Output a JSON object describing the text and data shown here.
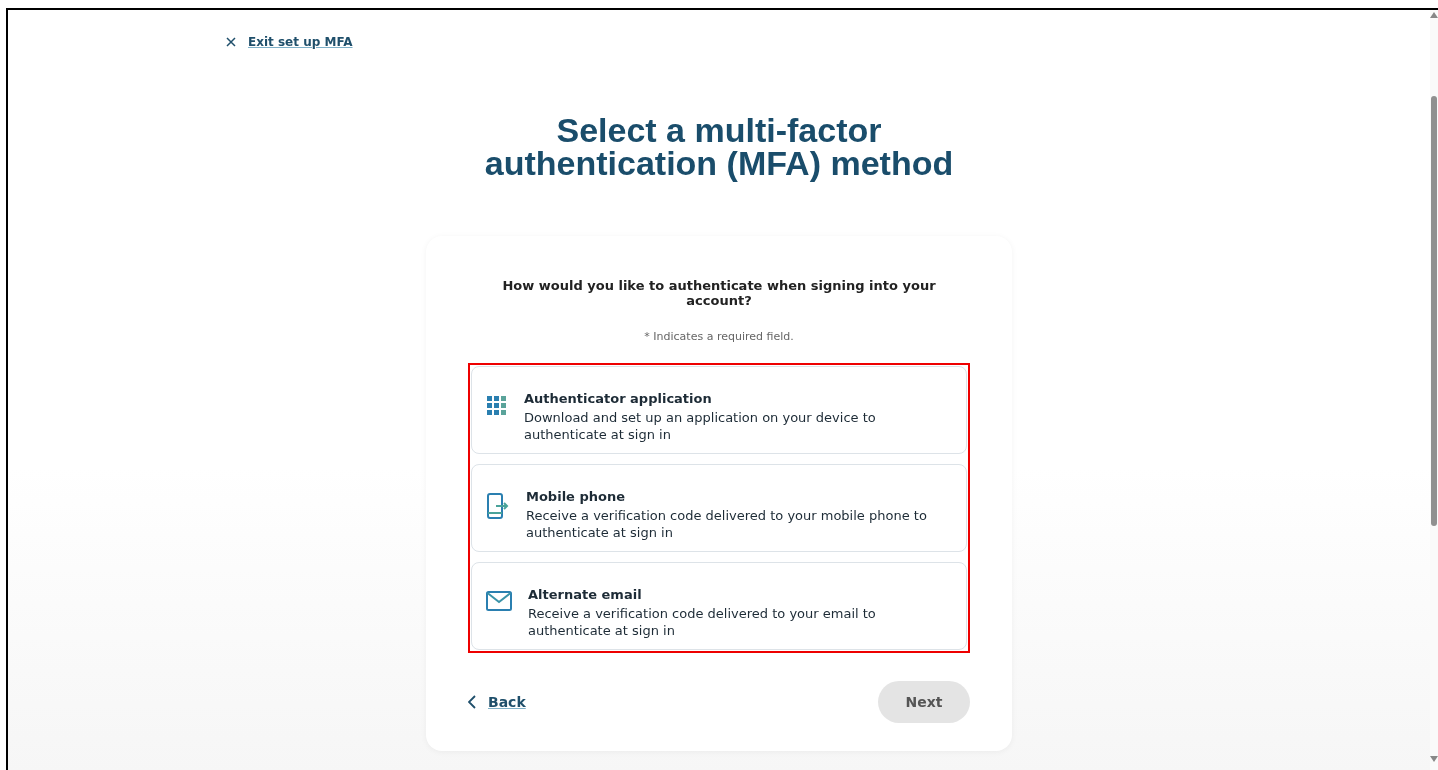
{
  "exit_link": {
    "label": "Exit set up MFA"
  },
  "title": "Select a multi-factor authentication (MFA) method",
  "card": {
    "question": "How would you like to authenticate when signing into your account?",
    "required_note": "* Indicates a required field.",
    "options": [
      {
        "kind": "app",
        "title": "Authenticator application",
        "description": "Download and set up an application on your device to authenticate at sign in",
        "selected": false
      },
      {
        "kind": "phone",
        "title": "Mobile phone",
        "description": "Receive a verification code delivered to your mobile phone to authenticate at sign in",
        "selected": false
      },
      {
        "kind": "email",
        "title": "Alternate email",
        "description": "Receive a verification code delivered to your email to authenticate at sign in",
        "selected": false
      }
    ],
    "back": {
      "label": "Back"
    },
    "next": {
      "label": "Next",
      "disabled": true
    }
  }
}
